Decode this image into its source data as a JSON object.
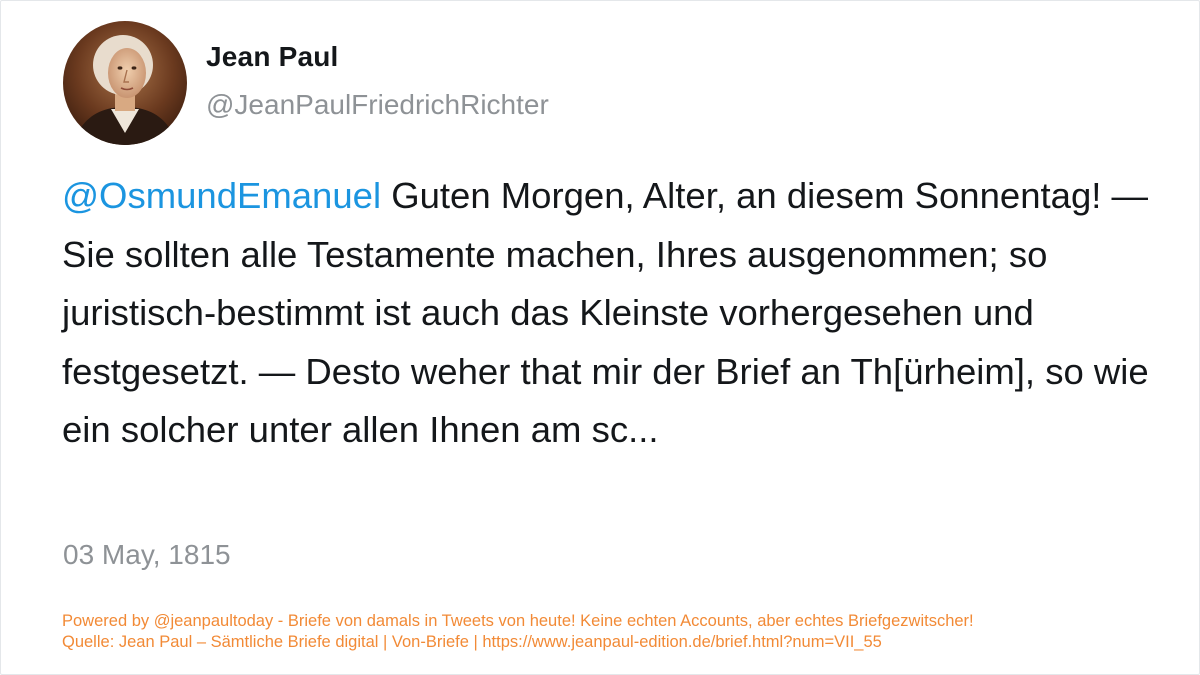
{
  "author": {
    "display_name": "Jean Paul",
    "handle": "@JeanPaulFriedrichRichter"
  },
  "tweet": {
    "mention": "@OsmundEmanuel",
    "text": " Guten Morgen, Alter, an diesem Sonnentag! — Sie sollten alle Testamente machen, Ihres ausgenommen; so juristisch-bestimmt ist auch das Kleinste vorhergesehen und festgesetzt. — Desto weher that mir der Brief an Th[ürheim], so wie ein solcher unter allen Ihnen am sc...",
    "date": "03 May, 1815"
  },
  "footer": {
    "line1": "Powered by @jeanpaultoday - Briefe von damals in Tweets von heute! Keine echten Accounts, aber echtes Briefgezwitscher!",
    "line2": "Quelle: Jean Paul – Sämtliche Briefe digital | Von-Briefe | https://www.jeanpaul-edition.de/brief.html?num=VII_55"
  },
  "colors": {
    "mention": "#1b95e0",
    "text": "#14171a",
    "muted": "#8e9296",
    "footer": "#f28a36"
  },
  "icons": {
    "avatar": "portrait-avatar"
  }
}
